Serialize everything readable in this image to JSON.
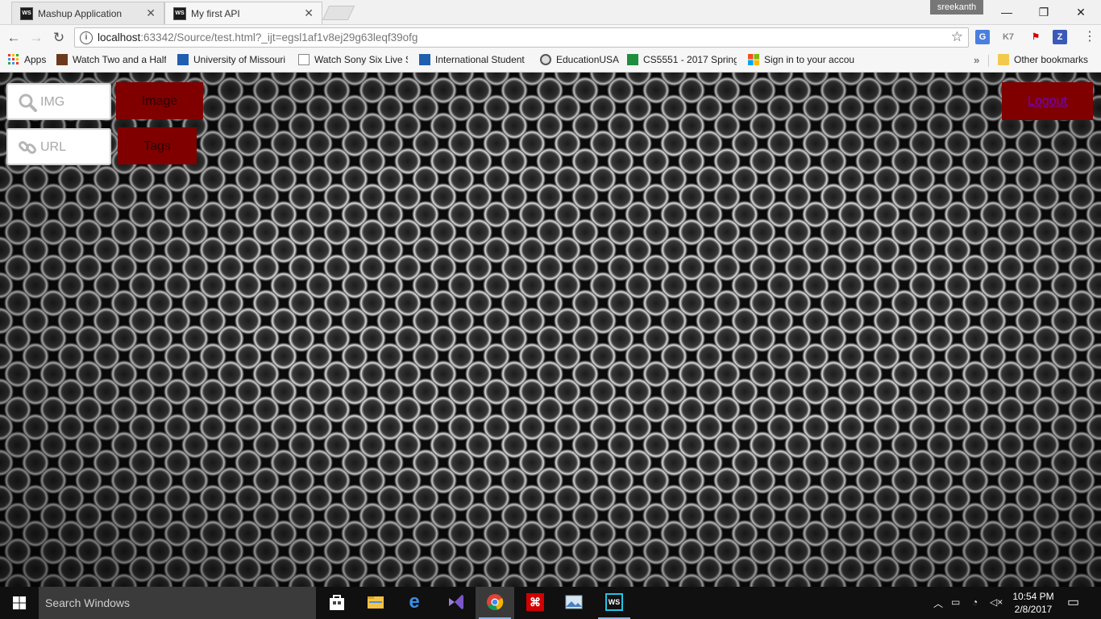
{
  "browser": {
    "tabs": [
      {
        "title": "Mashup Application",
        "favicon": "ws-icon",
        "active": false
      },
      {
        "title": "My first API",
        "favicon": "ws-icon",
        "active": true
      }
    ],
    "profile_name": "sreekanth",
    "url_host": "localhost",
    "url_rest": ":63342/Source/test.html?_ijt=egsl1af1v8ej29g63leqf39ofg",
    "bookmarks": [
      {
        "label": "Apps",
        "icon": "apps-grid-icon"
      },
      {
        "label": "Watch Two and a Half",
        "icon": "film-icon"
      },
      {
        "label": "University of Missouri",
        "icon": "flag-icon"
      },
      {
        "label": "Watch Sony Six Live St",
        "icon": "page-icon"
      },
      {
        "label": "International Student",
        "icon": "flag-icon"
      },
      {
        "label": "EducationUSA",
        "icon": "seal-icon"
      },
      {
        "label": "CS5551 - 2017 Spring",
        "icon": "sheets-icon"
      },
      {
        "label": "Sign in to your accou",
        "icon": "microsoft-icon"
      }
    ],
    "other_bookmarks": "Other bookmarks"
  },
  "page": {
    "img_placeholder": "IMG",
    "url_placeholder": "URL",
    "image_button": "Image",
    "tags_button": "Tags",
    "logout_link": "Logout",
    "button_color": "#800000"
  },
  "taskbar": {
    "search_placeholder": "Search Windows",
    "time": "10:54 PM",
    "date": "2/8/2017"
  }
}
